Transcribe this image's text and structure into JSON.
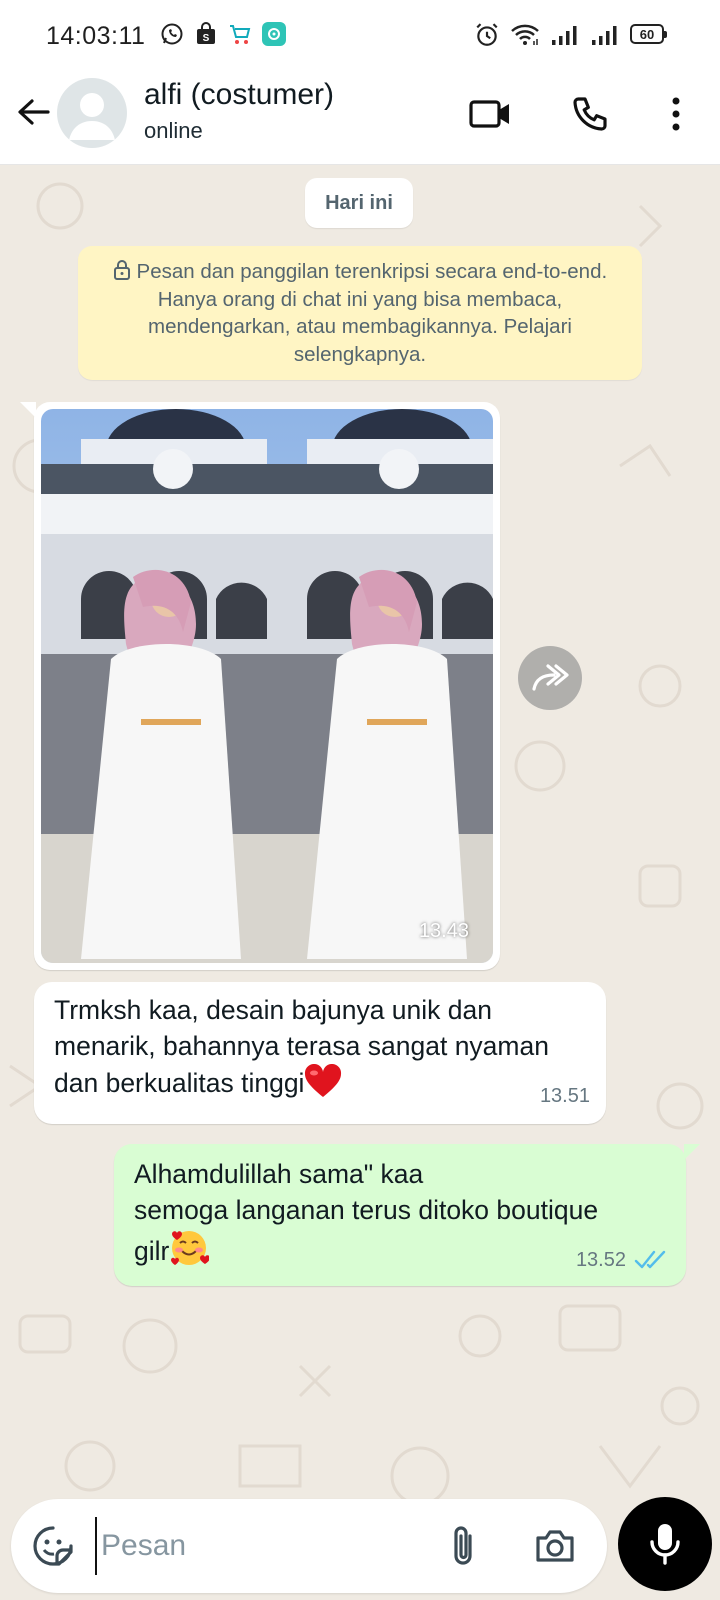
{
  "status_bar": {
    "time": "14:03:11",
    "battery": "60"
  },
  "header": {
    "contact_name": "alfi (costumer)",
    "contact_status": "online"
  },
  "chat": {
    "day_chip": "Hari ini",
    "encryption_notice": "Pesan dan panggilan terenkripsi secara end-to-end. Hanya orang di chat ini yang bisa membaca, mendengarkan, atau membagikannya. Pelajari selengkapnya.",
    "messages": [
      {
        "type": "image",
        "direction": "incoming",
        "time": "13.43"
      },
      {
        "type": "text",
        "direction": "incoming",
        "text": "Trmksh kaa, desain bajunya unik dan menarik, bahannya terasa sangat nyaman dan berkualitas tinggi",
        "emoji": "❤️",
        "time": "13.51"
      },
      {
        "type": "text",
        "direction": "outgoing",
        "line1": "Alhamdulillah sama\" kaa",
        "line2": "semoga langanan terus ditoko boutique",
        "line3": "gilr",
        "emoji": "🥰",
        "time": "13.52",
        "status": "read"
      }
    ]
  },
  "input": {
    "placeholder": "Pesan"
  },
  "colors": {
    "chat_background": "#efeae2",
    "outgoing_bubble": "#d9fdd3",
    "notice_bubble": "#fff5c4",
    "read_ticks": "#53bdeb"
  }
}
